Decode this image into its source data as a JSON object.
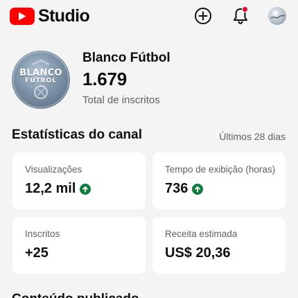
{
  "app": {
    "logo_text": "Studio"
  },
  "header_icons": {
    "create": "create-plus-icon",
    "notifications": "bell-icon",
    "account": "account-avatar"
  },
  "channel": {
    "name": "Blanco Fútbol",
    "avatar_text_line1": "BLANCO",
    "avatar_text_line2": "FÚTBOL",
    "subscriber_count": "1.679",
    "subscriber_label": "Total de inscritos"
  },
  "analytics": {
    "title": "Estatísticas do canal",
    "period": "Últimos 28 dias",
    "cards": [
      {
        "label": "Visualizações",
        "value": "12,2 mil",
        "trend": "up"
      },
      {
        "label": "Tempo de exibição (horas)",
        "value": "736",
        "trend": "up"
      },
      {
        "label": "Inscritos",
        "value": "+25",
        "trend": "none"
      },
      {
        "label": "Receita estimada",
        "value": "US$ 20,36",
        "trend": "none"
      }
    ]
  },
  "next_section": {
    "title": "Conteúdo publicado"
  },
  "colors": {
    "brand_red": "#ff0000",
    "trend_up_green": "#0f7b3e",
    "notification_dot": "#e1002d",
    "background": "#f4f4f4",
    "card": "#ffffff"
  }
}
